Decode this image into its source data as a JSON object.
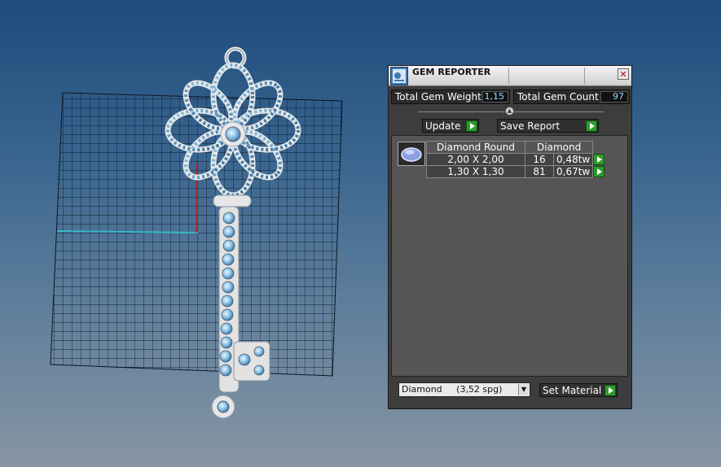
{
  "window": {
    "title": "GEM REPORTER",
    "close_glyph": "✕"
  },
  "stats": {
    "total_weight_label": "Total Gem Weight",
    "total_weight_value": "1,15",
    "total_count_label": "Total Gem Count",
    "total_count_value": "97"
  },
  "toolbar": {
    "update_label": "Update",
    "save_report_label": "Save Report"
  },
  "gem_table": {
    "header_shape": "Diamond Round",
    "header_material": "Diamond",
    "rows": [
      {
        "size": "2,00 X 2,00",
        "count": "16",
        "weight": "0,48tw"
      },
      {
        "size": "1,30 X 1,30",
        "count": "81",
        "weight": "0,67tw"
      }
    ]
  },
  "material": {
    "selected": "Diamond     (3,52 spg)",
    "set_label": "Set Material"
  },
  "colors": {
    "panel_bg": "#3d3d3d",
    "accent_green": "#2f9b2f",
    "value_text": "#8fd8ff"
  },
  "icons": {
    "app": "gem-reporter-app-icon",
    "play": "green-play-arrow-icon",
    "gem": "diamond-round-gem-icon"
  }
}
